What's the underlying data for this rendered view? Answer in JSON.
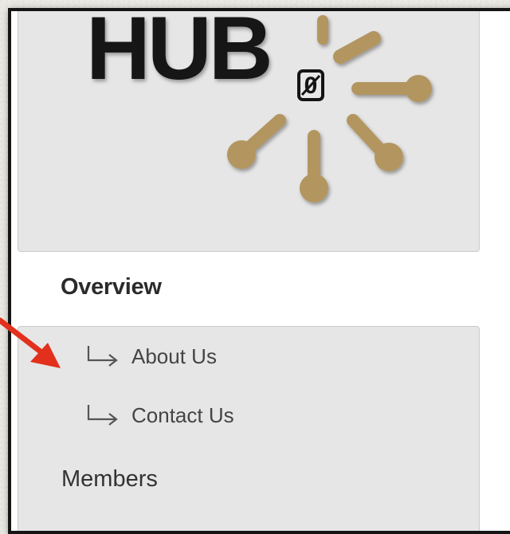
{
  "logo": {
    "text": "HUB",
    "subscript": "0",
    "accent_color": "#b3955e",
    "text_color": "#141414"
  },
  "nav": {
    "overview_label": "Overview",
    "submenu": [
      {
        "label": "About Us",
        "icon": "return-arrow-icon"
      },
      {
        "label": "Contact Us",
        "icon": "return-arrow-icon"
      }
    ],
    "members_label": "Members"
  },
  "annotation": {
    "icon": "red-pointer-arrow-icon",
    "color": "#e2301c"
  }
}
